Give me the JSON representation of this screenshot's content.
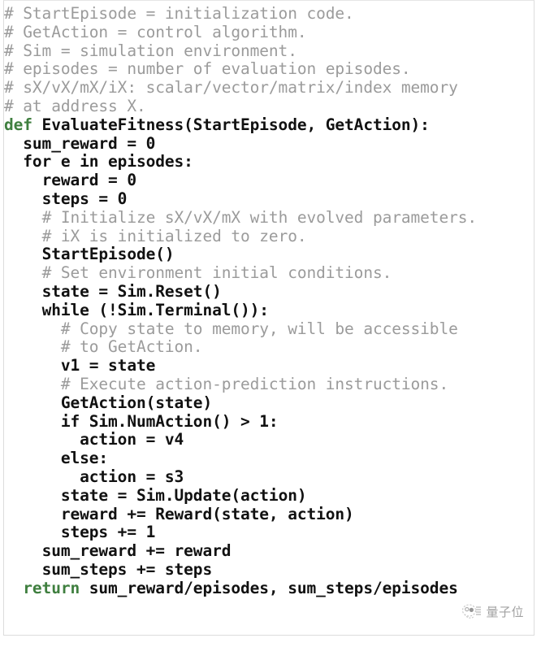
{
  "document": {
    "kind": "code-listing",
    "language": "python-pseudocode",
    "title": "EvaluateFitness pseudocode",
    "colors": {
      "background": "#ffffff",
      "border": "#dcdcdc",
      "comment": "#9b9b9b",
      "keyword": "#3f7f3f",
      "code": "#111111",
      "watermark": "#7d7d7d"
    }
  },
  "code": {
    "lines": [
      {
        "indent": 0,
        "tokens": [
          {
            "type": "comment",
            "text": "# StartEpisode = initialization code."
          }
        ]
      },
      {
        "indent": 0,
        "tokens": [
          {
            "type": "comment",
            "text": "# GetAction = control algorithm."
          }
        ]
      },
      {
        "indent": 0,
        "tokens": [
          {
            "type": "comment",
            "text": "# Sim = simulation environment."
          }
        ]
      },
      {
        "indent": 0,
        "tokens": [
          {
            "type": "comment",
            "text": "# episodes = number of evaluation episodes."
          }
        ]
      },
      {
        "indent": 0,
        "tokens": [
          {
            "type": "comment",
            "text": "# sX/vX/mX/iX: scalar/vector/matrix/index memory"
          }
        ]
      },
      {
        "indent": 0,
        "tokens": [
          {
            "type": "comment",
            "text": "# at address X."
          }
        ]
      },
      {
        "indent": 0,
        "tokens": [
          {
            "type": "keyword",
            "text": "def"
          },
          {
            "type": "code",
            "text": " EvaluateFitness(StartEpisode, GetAction):"
          }
        ]
      },
      {
        "indent": 1,
        "tokens": [
          {
            "type": "code",
            "text": "sum_reward = 0"
          }
        ]
      },
      {
        "indent": 1,
        "tokens": [
          {
            "type": "code",
            "text": "for e in episodes:"
          }
        ]
      },
      {
        "indent": 2,
        "tokens": [
          {
            "type": "code",
            "text": "reward = 0"
          }
        ]
      },
      {
        "indent": 2,
        "tokens": [
          {
            "type": "code",
            "text": "steps = 0"
          }
        ]
      },
      {
        "indent": 2,
        "tokens": [
          {
            "type": "comment",
            "text": "# Initialize sX/vX/mX with evolved parameters."
          }
        ]
      },
      {
        "indent": 2,
        "tokens": [
          {
            "type": "comment",
            "text": "# iX is initialized to zero."
          }
        ]
      },
      {
        "indent": 2,
        "tokens": [
          {
            "type": "code",
            "text": "StartEpisode()"
          }
        ]
      },
      {
        "indent": 2,
        "tokens": [
          {
            "type": "comment",
            "text": "# Set environment initial conditions."
          }
        ]
      },
      {
        "indent": 2,
        "tokens": [
          {
            "type": "code",
            "text": "state = Sim.Reset()"
          }
        ]
      },
      {
        "indent": 2,
        "tokens": [
          {
            "type": "code",
            "text": "while (!Sim.Terminal()):"
          }
        ]
      },
      {
        "indent": 3,
        "tokens": [
          {
            "type": "comment",
            "text": "# Copy state to memory, will be accessible"
          }
        ]
      },
      {
        "indent": 3,
        "tokens": [
          {
            "type": "comment",
            "text": "# to GetAction."
          }
        ]
      },
      {
        "indent": 3,
        "tokens": [
          {
            "type": "code",
            "text": "v1 = state"
          }
        ]
      },
      {
        "indent": 3,
        "tokens": [
          {
            "type": "comment",
            "text": "# Execute action-prediction instructions."
          }
        ]
      },
      {
        "indent": 3,
        "tokens": [
          {
            "type": "code",
            "text": "GetAction(state)"
          }
        ]
      },
      {
        "indent": 3,
        "tokens": [
          {
            "type": "code",
            "text": "if Sim.NumAction() > 1:"
          }
        ]
      },
      {
        "indent": 4,
        "tokens": [
          {
            "type": "code",
            "text": "action = v4"
          }
        ]
      },
      {
        "indent": 3,
        "tokens": [
          {
            "type": "code",
            "text": "else:"
          }
        ]
      },
      {
        "indent": 4,
        "tokens": [
          {
            "type": "code",
            "text": "action = s3"
          }
        ]
      },
      {
        "indent": 3,
        "tokens": [
          {
            "type": "code",
            "text": "state = Sim.Update(action)"
          }
        ]
      },
      {
        "indent": 3,
        "tokens": [
          {
            "type": "code",
            "text": "reward += Reward(state, action)"
          }
        ]
      },
      {
        "indent": 3,
        "tokens": [
          {
            "type": "code",
            "text": "steps += 1"
          }
        ]
      },
      {
        "indent": 2,
        "tokens": [
          {
            "type": "code",
            "text": "sum_reward += reward"
          }
        ]
      },
      {
        "indent": 2,
        "tokens": [
          {
            "type": "code",
            "text": "sum_steps += steps"
          }
        ]
      },
      {
        "indent": 1,
        "tokens": [
          {
            "type": "keyword",
            "text": "return"
          },
          {
            "type": "code",
            "text": " sum_reward/episodes, sum_steps/episodes"
          }
        ]
      }
    ]
  },
  "watermark": {
    "text": "量子位",
    "logo_icon": "qbitai-logo-icon"
  }
}
